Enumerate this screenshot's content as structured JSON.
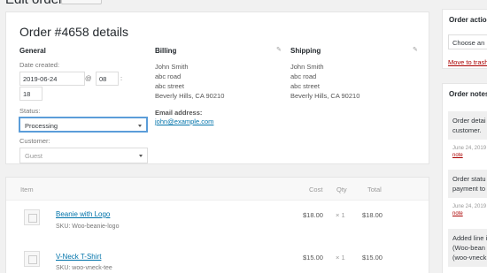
{
  "header": {
    "page_title": "Edit order"
  },
  "order": {
    "title": "Order #4658 details"
  },
  "general": {
    "heading": "General",
    "date_label": "Date created:",
    "date_value": "2019-06-24",
    "at": "@",
    "hour": "08",
    "colon": ":",
    "minute": "18",
    "status_label": "Status:",
    "status_value": "Processing",
    "customer_label": "Customer:",
    "customer_value": "Guest"
  },
  "billing": {
    "heading": "Billing",
    "lines": [
      "John Smith",
      "abc road",
      "abc street",
      "Beverly Hills, CA 90210"
    ],
    "email_label": "Email address:",
    "email": "john@example.com"
  },
  "shipping": {
    "heading": "Shipping",
    "lines": [
      "John Smith",
      "abc road",
      "abc street",
      "Beverly Hills, CA 90210"
    ]
  },
  "items_table": {
    "headers": {
      "item": "Item",
      "cost": "Cost",
      "qty": "Qty",
      "total": "Total"
    },
    "rows": [
      {
        "name": "Beanie with Logo",
        "sku": "SKU: Woo-beanie-logo",
        "cost": "$18.00",
        "qty": "× 1",
        "total": "$18.00"
      },
      {
        "name": "V-Neck T-Shirt",
        "sku": "SKU: woo-vneck-tee",
        "cost": "$15.00",
        "qty": "× 1",
        "total": "$15.00"
      }
    ]
  },
  "sidebar": {
    "actions_title": "Order actio",
    "actions_select": "Choose an",
    "move_trash": "Move to trash",
    "notes_title": "Order notes",
    "notes": [
      {
        "text1": "Order detai",
        "text2": "customer.",
        "meta": "June 24, 2019",
        "delete": "note"
      },
      {
        "text1": "Order statu",
        "text2": "payment to",
        "meta": "June 24, 2019",
        "delete": "note"
      },
      {
        "text1": "Added line i",
        "text2": "(Woo-bean",
        "text3": "(woo-vneck",
        "meta": "",
        "delete": ""
      }
    ]
  }
}
